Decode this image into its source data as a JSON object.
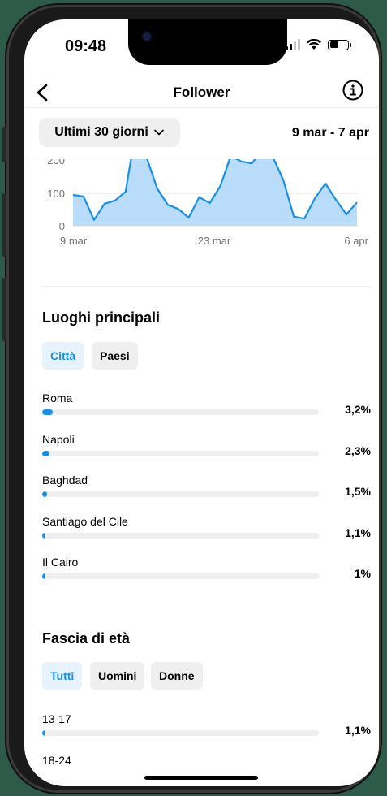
{
  "status_bar": {
    "time": "09:48"
  },
  "header": {
    "title": "Follower",
    "back_icon": "chevron-left-icon",
    "info_icon": "info-circle-icon"
  },
  "filter": {
    "range_label": "Ultimi 30 giorni",
    "date_range": "9 mar - 7 apr"
  },
  "chart_data": {
    "type": "area",
    "y_ticks": [
      "200",
      "100",
      "0"
    ],
    "x_ticks": [
      "9 mar",
      "23 mar",
      "6 apr"
    ],
    "ylim": [
      0,
      200
    ],
    "values": [
      95,
      90,
      18,
      68,
      78,
      105,
      300,
      210,
      115,
      65,
      52,
      25,
      88,
      70,
      122,
      215,
      198,
      192,
      235,
      212,
      140,
      28,
      22,
      85,
      130,
      80,
      35,
      72
    ],
    "fill_color": "#b9dcfa",
    "line_color": "#1a8fe3"
  },
  "locations": {
    "title": "Luoghi principali",
    "tabs": [
      "Città",
      "Paesi"
    ],
    "active_tab": "Città",
    "items": [
      {
        "label": "Roma",
        "value": "3,2%",
        "pct": 3.2
      },
      {
        "label": "Napoli",
        "value": "2,3%",
        "pct": 2.3
      },
      {
        "label": "Baghdad",
        "value": "1,5%",
        "pct": 1.5
      },
      {
        "label": "Santiago del Cile",
        "value": "1,1%",
        "pct": 1.1
      },
      {
        "label": "Il Cairo",
        "value": "1%",
        "pct": 1.0
      }
    ]
  },
  "age": {
    "title": "Fascia di età",
    "tabs": [
      "Tutti",
      "Uomini",
      "Donne"
    ],
    "active_tab": "Tutti",
    "items": [
      {
        "label": "13-17",
        "value": "1,1%",
        "pct": 1.1
      },
      {
        "label": "18-24",
        "value": "",
        "pct": 0
      }
    ]
  },
  "colors": {
    "accent": "#1a8fe3",
    "chip_active_bg": "#e6f3fc",
    "chip_bg": "#efefef",
    "frame": "#2e5a4a"
  }
}
